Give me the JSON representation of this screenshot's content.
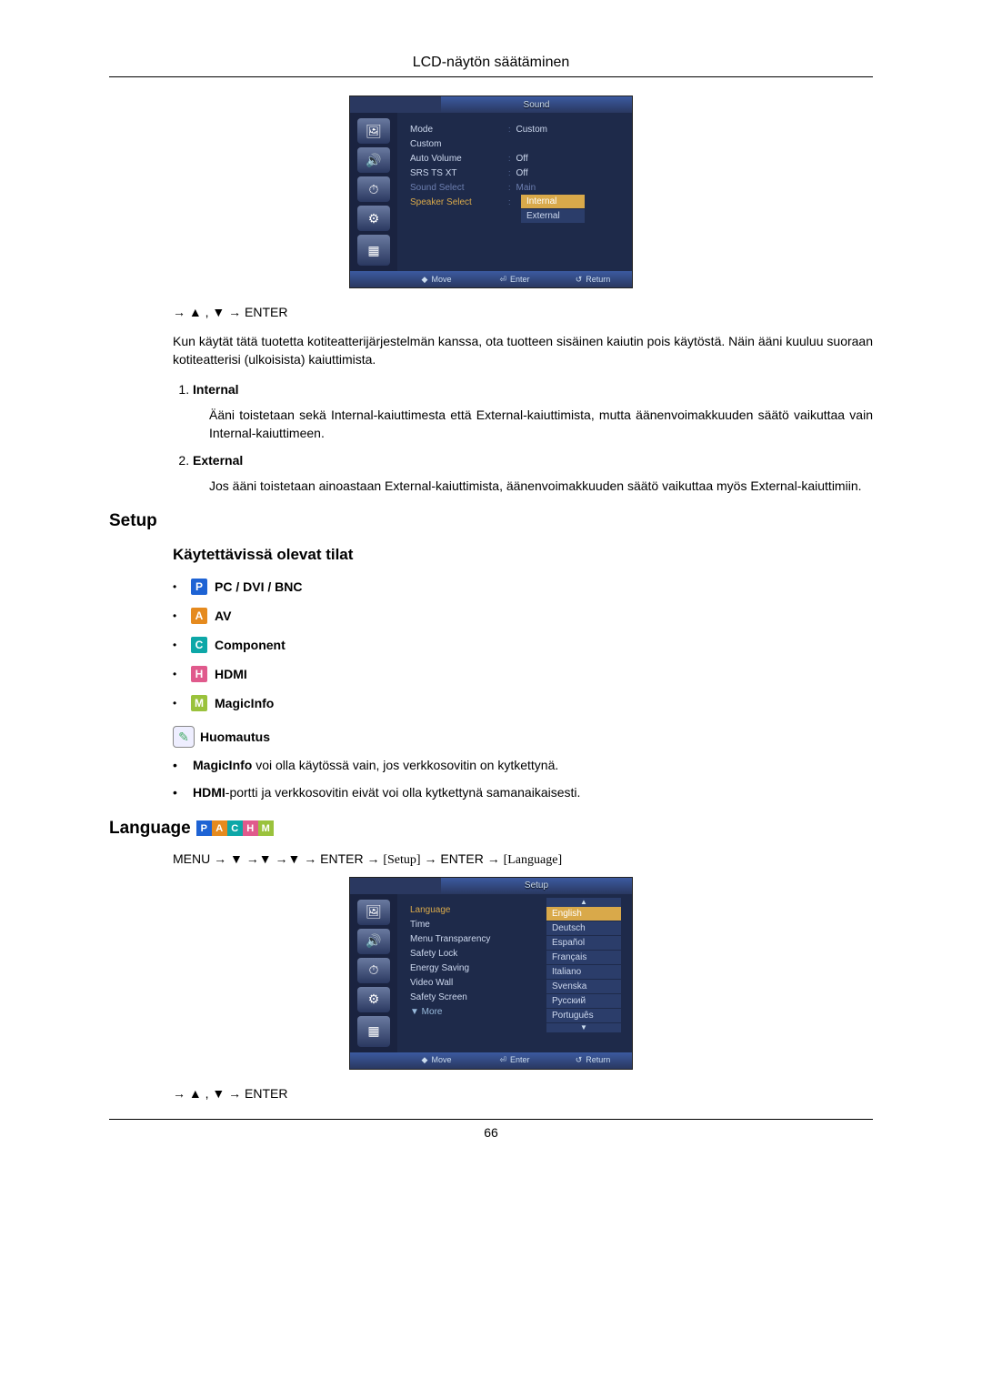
{
  "header": {
    "title": "LCD-näytön säätäminen"
  },
  "page_number": "66",
  "osd1": {
    "title": "Sound",
    "rows": [
      {
        "label": "Mode",
        "value": "Custom",
        "dim": false
      },
      {
        "label": "Custom",
        "value": "",
        "dim": false
      },
      {
        "label": "Auto Volume",
        "value": "Off",
        "dim": false
      },
      {
        "label": "SRS TS XT",
        "value": "Off",
        "dim": false
      },
      {
        "label": "Sound Select",
        "value": "Main",
        "dim": true
      },
      {
        "label": "Speaker Select",
        "value": "Internal",
        "dim": false,
        "selected": true
      }
    ],
    "dropdown": [
      {
        "label": "Internal",
        "selected": true
      },
      {
        "label": "External",
        "selected": false
      }
    ],
    "footer": {
      "move": "Move",
      "enter": "Enter",
      "return": "Return"
    }
  },
  "nav1": "→ ▲ , ▼ → ENTER",
  "para_intro": "Kun käytät tätä tuotetta kotiteatterijärjestelmän kanssa, ota tuotteen sisäinen kaiutin pois käytöstä. Näin ääni kuuluu suoraan kotiteatterisi (ulkoisista) kaiuttimista.",
  "list_items": [
    {
      "title": "Internal",
      "body": "Ääni toistetaan sekä Internal-kaiuttimesta että External-kaiuttimista, mutta äänenvoimakkuuden säätö vaikuttaa vain Internal-kaiuttimeen."
    },
    {
      "title": "External",
      "body": "Jos ääni toistetaan ainoastaan External-kaiuttimista, äänenvoimakkuuden säätö vaikuttaa myös External-kaiuttimiin."
    }
  ],
  "setup_heading": "Setup",
  "modes_heading": "Käytettävissä olevat tilat",
  "modes": [
    {
      "letter": "P",
      "cls": "mb-P",
      "label": "PC / DVI / BNC"
    },
    {
      "letter": "A",
      "cls": "mb-A",
      "label": "AV"
    },
    {
      "letter": "C",
      "cls": "mb-C",
      "label": "Component"
    },
    {
      "letter": "H",
      "cls": "mb-H",
      "label": "HDMI"
    },
    {
      "letter": "M",
      "cls": "mb-M",
      "label": "MagicInfo"
    }
  ],
  "note_label": "Huomautus",
  "notes": [
    "MagicInfo voi olla käytössä vain, jos verkkosovitin on kytkettynä.",
    "HDMI-portti ja verkkosovitin eivät voi olla kytkettynä samanaikaisesti."
  ],
  "language_heading": "Language",
  "menu_path": {
    "p1": "MENU → ▼ →▼ →▼ → ENTER → ",
    "b1": "[Setup]",
    "p2": " → ENTER → ",
    "b2": "[Language]"
  },
  "osd2": {
    "title": "Setup",
    "rows": [
      {
        "label": "Language",
        "opt": "English",
        "selected": true
      },
      {
        "label": "Time",
        "opt": "Deutsch"
      },
      {
        "label": "Menu Transparency",
        "opt": "Español"
      },
      {
        "label": "Safety Lock",
        "opt": "Français"
      },
      {
        "label": "Energy Saving",
        "opt": "Italiano"
      },
      {
        "label": "Video Wall",
        "opt": "Svenska"
      },
      {
        "label": "Safety Screen",
        "opt": "Русский"
      },
      {
        "label": "▼ More",
        "opt": "Português",
        "more": true
      }
    ],
    "footer": {
      "move": "Move",
      "enter": "Enter",
      "return": "Return"
    }
  },
  "nav2": "→ ▲ , ▼ → ENTER"
}
